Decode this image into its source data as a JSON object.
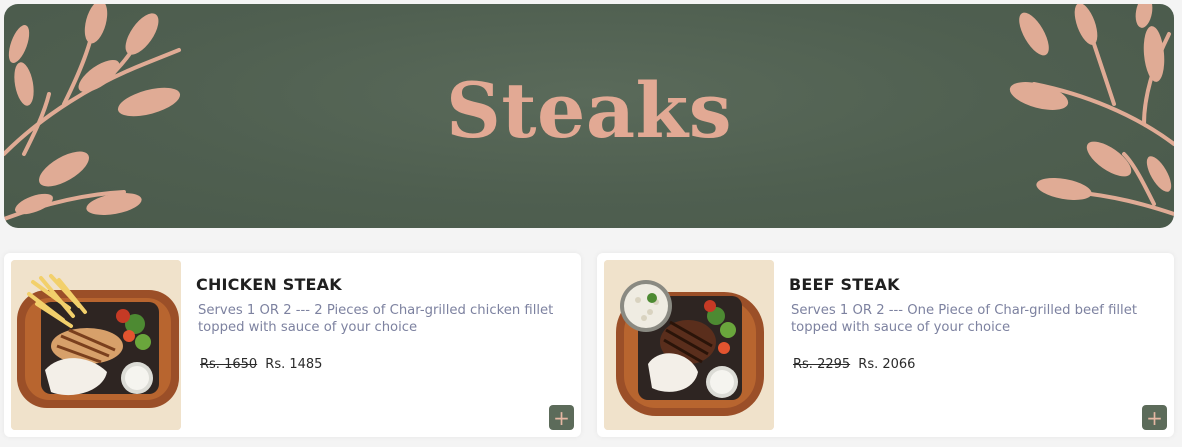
{
  "banner": {
    "title": "Steaks",
    "background_color": "#4f5f50",
    "accent_color": "#e2a994"
  },
  "products": [
    {
      "name": "CHICKEN STEAK",
      "description": "Serves 1 OR 2 --- 2 Pieces of Char-grilled chicken fillet topped with sauce of your choice",
      "old_price": "Rs. 1650",
      "price": "Rs. 1485",
      "add_icon": "plus-icon"
    },
    {
      "name": "BEEF STEAK",
      "description": "Serves 1 OR 2 --- One Piece of Char-grilled beef fillet topped with sauce of your choice",
      "old_price": "Rs. 2295",
      "price": "Rs. 2066",
      "add_icon": "plus-icon"
    }
  ],
  "colors": {
    "button_bg": "#5c6b5a",
    "button_icon": "#e6b7a3",
    "description_text": "#7d82a0"
  }
}
